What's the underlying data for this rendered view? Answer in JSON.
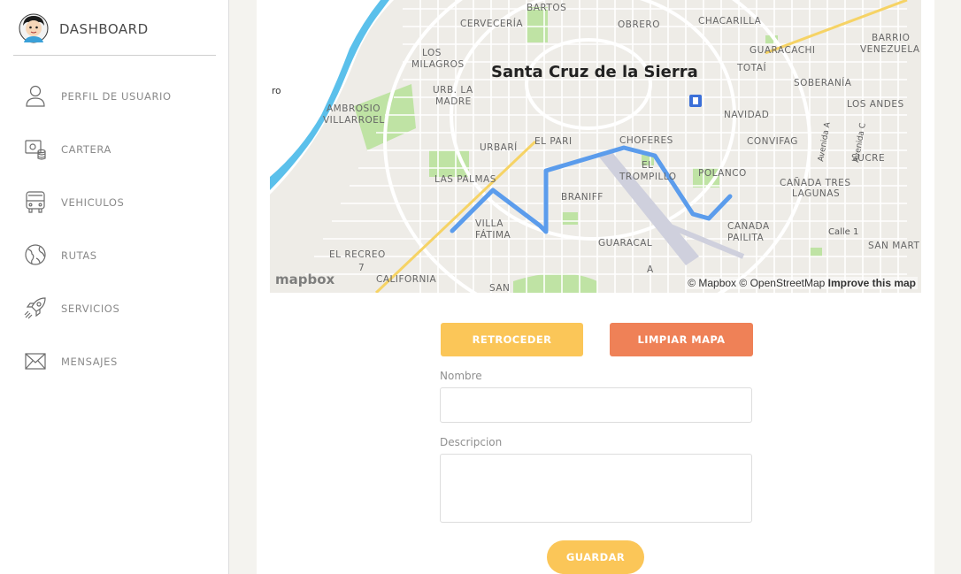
{
  "sidebar": {
    "brand_title": "DASHBOARD",
    "items": [
      {
        "label": "PERFIL DE USUARIO",
        "icon": "user-icon"
      },
      {
        "label": "CARTERA",
        "icon": "wallet-icon"
      },
      {
        "label": "VEHICULOS",
        "icon": "bus-icon"
      },
      {
        "label": "RUTAS",
        "icon": "globe-icon"
      },
      {
        "label": "SERVICIOS",
        "icon": "rocket-icon"
      },
      {
        "label": "MENSAJES",
        "icon": "mail-icon"
      }
    ]
  },
  "map": {
    "city": "Santa Cruz de la Sierra",
    "attribution_mapbox": "© Mapbox",
    "attribution_osm": "© OpenStreetMap",
    "improve": "Improve this map",
    "logo": "mapbox",
    "places": [
      "BARTOS",
      "CERVECERÍA",
      "OBRERO",
      "CHACARILLA",
      "GUARACACHI",
      "BARRIO",
      "VENEZUELA",
      "LOS",
      "MILAGROS",
      "TOTAÍ",
      "SOBERANÍA",
      "LOS ANDES",
      "URB. LA",
      "MADRE",
      "AMBROSIO",
      "VILLARROEL",
      "NAVIDAD",
      "CONVIFAG",
      "URBARÍ",
      "EL PARI",
      "CHOFERES",
      "SUCRE",
      "EL",
      "TROMPILLO",
      "POLANCO",
      "LAS PALMAS",
      "CAÑADA TRES",
      "LAGUNAS",
      "BRANIFF",
      "VILLA",
      "FÁTIMA",
      "CANADA",
      "PAILITA",
      "Calle 1",
      "GUARACAL",
      "SAN MART",
      "EL RECREO",
      "CALIFORNIA",
      "SAN",
      "Avenida A",
      "Avenida C",
      "ro",
      "7",
      "A"
    ]
  },
  "form": {
    "back_label": "RETROCEDER",
    "clear_label": "LIMPIAR MAPA",
    "name_label": "Nombre",
    "name_value": "",
    "desc_label": "Descripcion",
    "desc_value": "",
    "save_label": "GUARDAR"
  },
  "colors": {
    "warning": "#fbc658",
    "danger": "#ef8157",
    "route": "#5b9cec",
    "river": "#5bc0eb"
  }
}
